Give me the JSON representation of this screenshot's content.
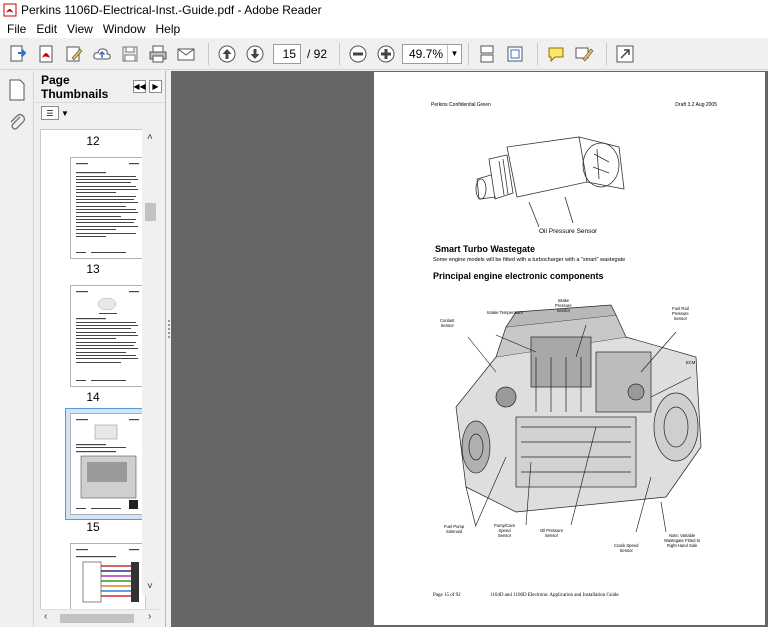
{
  "window": {
    "title": "Perkins 1106D-Electrical-Inst.-Guide.pdf - Adobe Reader"
  },
  "menu": [
    "File",
    "Edit",
    "View",
    "Window",
    "Help"
  ],
  "toolbar": {
    "page_current": "15",
    "page_total": "/ 92",
    "zoom": "49.7%"
  },
  "thumbnails": {
    "title": "Page Thumbnails",
    "pages": [
      "12",
      "13",
      "14",
      "15"
    ],
    "selected": "14"
  },
  "document": {
    "header_left": "Perkins Confidential Green",
    "header_right": "Draft 3.2   Aug 2005",
    "sensor_caption": "Oil Pressure Sensor",
    "heading_smart": "Smart Turbo Wastegate",
    "para_smart": "Some engine models will be fitted with a turbocharger with a \"smart\" wastegate",
    "heading_principal": "Principal engine electronic components",
    "labels": {
      "intake_temp": "Intake Temperature",
      "intake_pressure": "Intake\nPressure\nSensor",
      "coolant": "Coolant\nSensor",
      "fuel_rail": "Fuel Rail\nPressure\nSensor",
      "ecm": "ECM",
      "fuel_pump": "Fuel Pump\nSolenoid",
      "pump_cam": "Pump/Cam\nSpeed\nSensor",
      "oil_pressure": "Oil Pressure\nSensor",
      "crank": "Crank Speed\nSensor",
      "note": "Note: Variable\nWastegate Fitted to\nRight Hand Side"
    },
    "footer_left": "Page 15 of 92",
    "footer_right": "1104D and 1106D Electronic Application and Installation Guide"
  }
}
